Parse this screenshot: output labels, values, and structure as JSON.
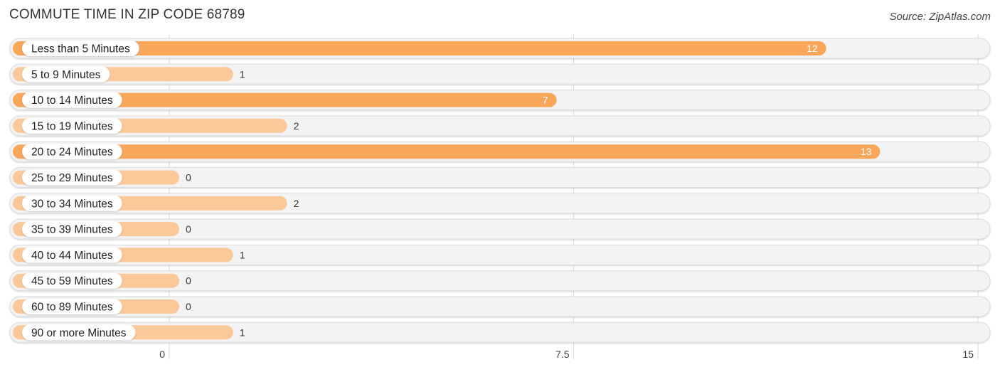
{
  "chart_data": {
    "type": "bar",
    "orientation": "horizontal",
    "title": "COMMUTE TIME IN ZIP CODE 68789",
    "source": "Source: ZipAtlas.com",
    "xlabel": "",
    "ylabel": "",
    "xlim": [
      0,
      15
    ],
    "ticks": [
      0,
      7.5,
      15
    ],
    "tick_labels": [
      "0",
      "7.5",
      "15"
    ],
    "grid": true,
    "legend": "none",
    "categories": [
      "Less than 5 Minutes",
      "5 to 9 Minutes",
      "10 to 14 Minutes",
      "15 to 19 Minutes",
      "20 to 24 Minutes",
      "25 to 29 Minutes",
      "30 to 34 Minutes",
      "35 to 39 Minutes",
      "40 to 44 Minutes",
      "45 to 59 Minutes",
      "60 to 89 Minutes",
      "90 or more Minutes"
    ],
    "values": [
      12,
      1,
      7,
      2,
      13,
      0,
      2,
      0,
      1,
      0,
      0,
      1
    ],
    "colors": {
      "high": "#f9a75a",
      "low": "#fbc89a",
      "track": "#f3f3f3",
      "grid": "#d8d8d8"
    }
  }
}
